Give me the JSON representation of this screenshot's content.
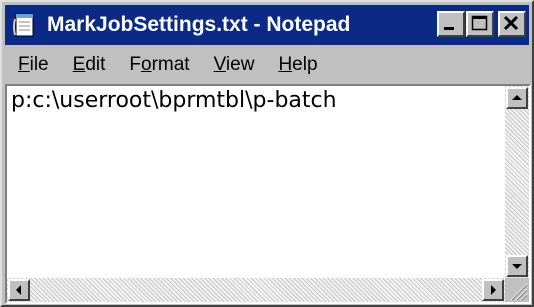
{
  "window": {
    "title": "MarkJobSettings.txt - Notepad"
  },
  "menu": {
    "items": [
      {
        "label": "File",
        "accel": "F",
        "rest": "ile"
      },
      {
        "label": "Edit",
        "accel": "E",
        "rest": "dit"
      },
      {
        "label": "Format",
        "pre": "F",
        "accel": "o",
        "rest": "rmat"
      },
      {
        "label": "View",
        "accel": "V",
        "rest": "iew"
      },
      {
        "label": "Help",
        "accel": "H",
        "rest": "elp"
      }
    ]
  },
  "editor": {
    "content": "p:c:\\userroot\\bprmtbl\\p-batch"
  },
  "icons": {
    "app": "notepad-icon",
    "minimize": "minimize-icon",
    "maximize": "maximize-icon",
    "close": "close-icon"
  },
  "colors": {
    "titlebar": "#0a2a86",
    "face": "#c0c0c0"
  }
}
